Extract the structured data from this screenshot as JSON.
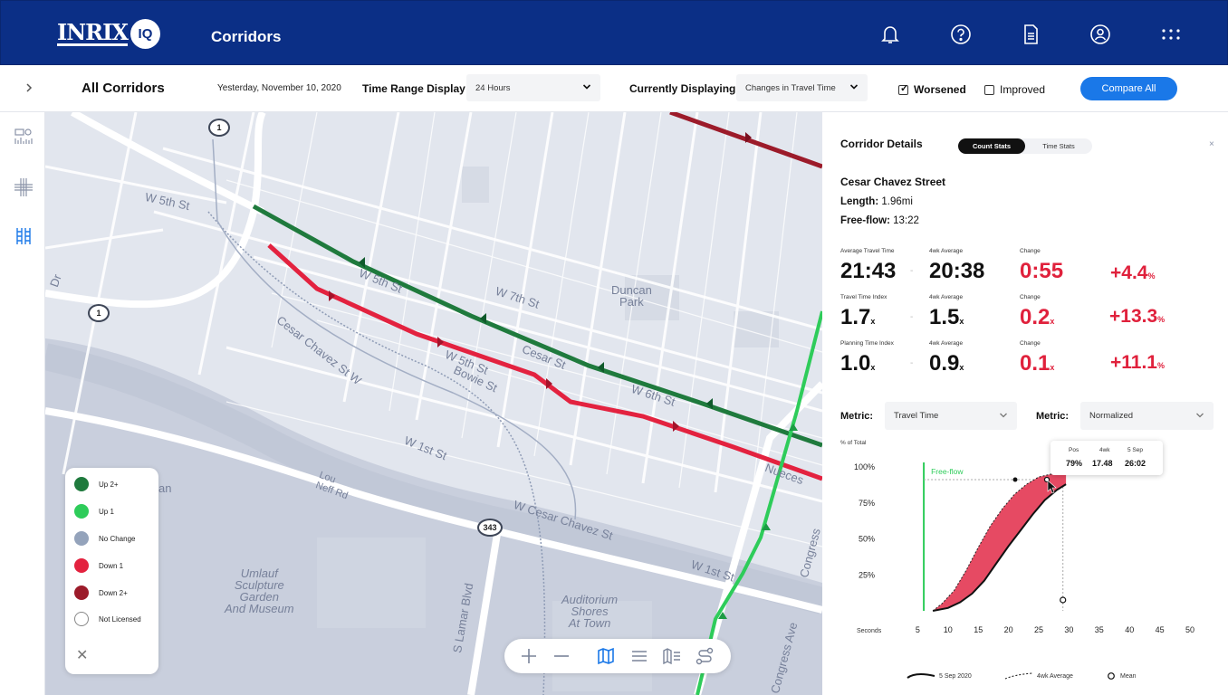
{
  "header": {
    "logo_text": "INRIX",
    "logo_badge": "IQ",
    "app_title": "Corridors",
    "icons": [
      "bell-icon",
      "help-icon",
      "document-icon",
      "account-icon",
      "apps-grid-icon"
    ]
  },
  "filters": {
    "page_title": "All Corridors",
    "date": "Yesterday, November 10, 2020",
    "time_range_label": "Time Range Display",
    "time_range_value": "24 Hours",
    "displaying_label": "Currently Displaying",
    "displaying_value": "Changes in Travel Time",
    "worsened_label": "Worsened",
    "worsened_checked": true,
    "improved_label": "Improved",
    "improved_checked": false,
    "compare_label": "Compare All"
  },
  "map": {
    "labels": {
      "w5th": "W 5th St",
      "w7th": "W 7th St",
      "duncan": "Duncan\nPark",
      "cesar_w": "Cesar Chavez St W",
      "w1st_a": "W 1st St",
      "wcesar": "W Cesar Chavez St",
      "w1st_b": "W 1st St",
      "umlauf": "Umlauf\nSculpture\nGarden\nAnd Museum",
      "auditorium": "Auditorium\nShores\nAt Town",
      "lamar": "S Lamar Blvd",
      "congress": "Congress",
      "congress_ave": "Congress Ave",
      "lou": "Lou\nNeff Rd",
      "an": "an",
      "dr": "Dr",
      "w5th_corr": "W 5th St",
      "cesar_corr": "Cesar St",
      "w5th_b": "W 5th St",
      "w6th": "W 6th St",
      "bowie": "Bowie St",
      "nueces": "Nueces"
    },
    "shields": [
      "1",
      "1",
      "343"
    ],
    "colors": {
      "up2": "#1f7a3d",
      "up1": "#2ecc5a",
      "nochange": "#94a3bb",
      "down1": "#e3223f",
      "down2": "#9c1b2a"
    }
  },
  "legend": {
    "items": [
      {
        "label": "Up 2+",
        "color": "#1f7a3d",
        "hollow": false
      },
      {
        "label": "Up 1",
        "color": "#2ecc5a",
        "hollow": false
      },
      {
        "label": "No Change",
        "color": "#94a3bb",
        "hollow": false
      },
      {
        "label": "Down 1",
        "color": "#e3223f",
        "hollow": false
      },
      {
        "label": "Down 2+",
        "color": "#9c1b2a",
        "hollow": false
      },
      {
        "label": "Not Licensed",
        "color": "#ffffff",
        "hollow": true
      }
    ],
    "close": "✕"
  },
  "map_tools": [
    "zoom-in-icon",
    "zoom-out-icon",
    "map-icon",
    "list-icon",
    "map-legend-icon",
    "route-icon"
  ],
  "panel": {
    "title": "Corridor Details",
    "tab_count": "Count Stats",
    "tab_time": "Time Stats",
    "close": "×",
    "street": "Cesar Chavez Street",
    "length_label": "Length:",
    "length_value": "1.96mi",
    "freeflow_label": "Free-flow:",
    "freeflow_value": "13:22",
    "stats": [
      {
        "label": "Average Travel Time",
        "value": "21:43",
        "suffix": "",
        "avg_label": "4wk Average",
        "avg": "20:38",
        "avg_suffix": "",
        "change_label": "Change",
        "change": "0:55",
        "change_suffix": "",
        "pct": "+4.4",
        "pct_suffix": "%"
      },
      {
        "label": "Travel Time Index",
        "value": "1.7",
        "suffix": "x",
        "avg_label": "4wk Average",
        "avg": "1.5",
        "avg_suffix": "x",
        "change_label": "Change",
        "change": "0.2",
        "change_suffix": "x",
        "pct": "+13.3",
        "pct_suffix": "%"
      },
      {
        "label": "Planning Time Index",
        "value": "1.0",
        "suffix": "x",
        "avg_label": "4wk Average",
        "avg": "0.9",
        "avg_suffix": "x",
        "change_label": "Change",
        "change": "0.1",
        "change_suffix": "x",
        "pct": "+11.1",
        "pct_suffix": "%"
      }
    ],
    "metric1_label": "Metric:",
    "metric1_value": "Travel Time",
    "metric2_label": "Metric:",
    "metric2_value": "Normalized"
  },
  "chart_data": {
    "type": "area",
    "ylabel": "% of Total",
    "xlabel": "Seconds",
    "x_ticks": [
      5,
      10,
      15,
      20,
      25,
      30,
      35,
      40,
      45,
      50
    ],
    "y_ticks": [
      "25%",
      "50%",
      "75%",
      "100%"
    ],
    "xlim": [
      0,
      50
    ],
    "ylim": [
      0,
      100
    ],
    "freeflow_label": "Free-flow",
    "freeflow_x": 6,
    "series": [
      {
        "name": "5 Sep 2020",
        "x": [
          7.5,
          10,
          12,
          14,
          16,
          18,
          20,
          22,
          24,
          26,
          28,
          29.5
        ],
        "y": [
          0,
          2,
          6,
          12,
          21,
          33,
          45,
          56,
          67,
          77,
          84,
          88
        ]
      },
      {
        "name": "4wk Average",
        "x": [
          7.5,
          9,
          11,
          13,
          15,
          17,
          19,
          21,
          23,
          25,
          27,
          29.5
        ],
        "y": [
          0,
          5,
          14,
          28,
          44,
          59,
          71,
          81,
          88,
          93,
          95,
          97
        ]
      }
    ],
    "mean_x": 29,
    "tooltip": {
      "pos_label": "Pos",
      "pos": "79%",
      "avg_label": "4wk",
      "avg": "17.48",
      "date_label": "5 Sep",
      "date": "26:02"
    },
    "legend": [
      {
        "label": "5 Sep 2020",
        "style": "solid"
      },
      {
        "label": "4wk Average",
        "style": "dashed"
      },
      {
        "label": "Mean",
        "style": "circle"
      }
    ]
  }
}
